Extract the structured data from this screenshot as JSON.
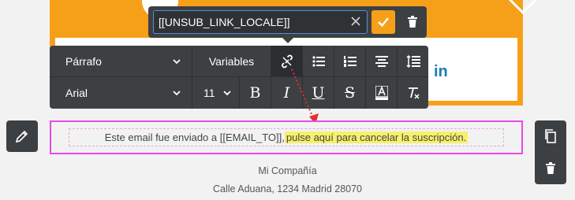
{
  "popover": {
    "link_value": "[[UNSUB_LINK_LOCALE]]"
  },
  "toolbar": {
    "paragraph_select": "Párrafo",
    "variables_label": "Variables",
    "font_select": "Arial",
    "size_select": "11",
    "bold_glyph": "B",
    "italic_glyph": "I",
    "underline_glyph": "U",
    "strike_glyph": "S"
  },
  "footer": {
    "sent_text": "Este email fue enviado a [[EMAIL_TO]], ",
    "unsubscribe_link": "pulse aquí para cancelar la suscripción.",
    "company_name": "Mi Compañía",
    "address": "Calle Aduana, 1234 Madrid 28070"
  },
  "colors": {
    "accent": "#f6a01a",
    "toolbar": "#3c4043",
    "selection": "#e849e8",
    "highlight": "#f7f06b"
  },
  "icons": [
    "check-icon",
    "trash-icon",
    "clear-icon",
    "unlink-icon",
    "bullet-list-icon",
    "numbered-list-icon",
    "align-center-icon",
    "line-height-icon",
    "text-color-icon",
    "clear-format-icon",
    "pencil-icon",
    "copy-icon",
    "chevron-down-icon",
    "linkedin-icon"
  ]
}
